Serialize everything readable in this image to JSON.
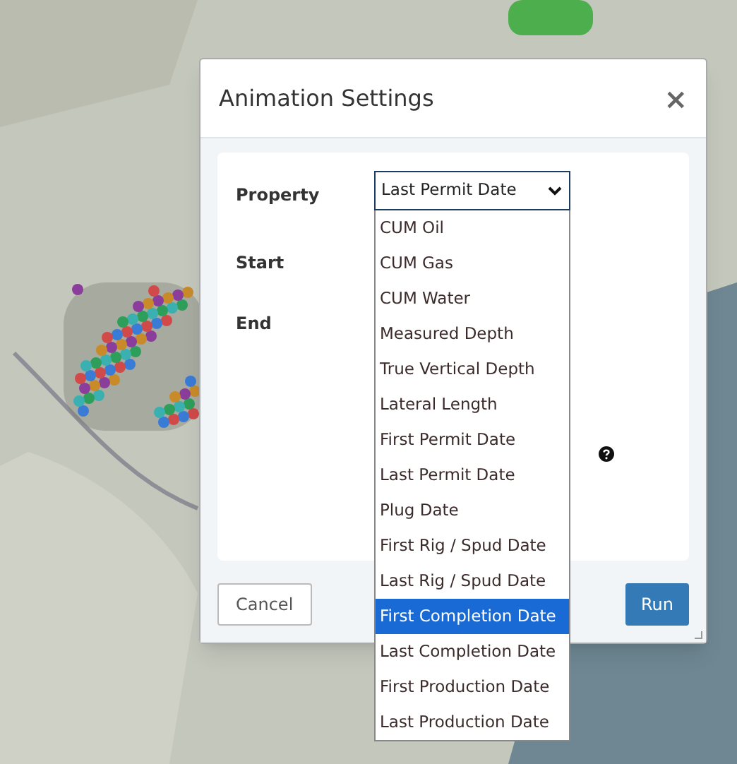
{
  "dialog": {
    "title": "Animation Settings",
    "close": "×",
    "property": {
      "label": "Property",
      "value": "Last Permit Date"
    },
    "options": [
      {
        "label": "CUM Oil",
        "selected": false
      },
      {
        "label": "CUM Gas",
        "selected": false
      },
      {
        "label": "CUM Water",
        "selected": false
      },
      {
        "label": "Measured Depth",
        "selected": false
      },
      {
        "label": "True Vertical Depth",
        "selected": false
      },
      {
        "label": "Lateral Length",
        "selected": false
      },
      {
        "label": "First Permit Date",
        "selected": false
      },
      {
        "label": "Last Permit Date",
        "selected": false
      },
      {
        "label": "Plug Date",
        "selected": false
      },
      {
        "label": "First Rig / Spud Date",
        "selected": false
      },
      {
        "label": "Last Rig / Spud Date",
        "selected": false
      },
      {
        "label": "First Completion Date",
        "selected": true
      },
      {
        "label": "Last Completion Date",
        "selected": false
      },
      {
        "label": "First Production Date",
        "selected": false
      },
      {
        "label": "Last Production Date",
        "selected": false
      }
    ],
    "start_label": "Start",
    "end_label": "End",
    "buttons": {
      "cancel": "Cancel",
      "run": "Run"
    }
  }
}
